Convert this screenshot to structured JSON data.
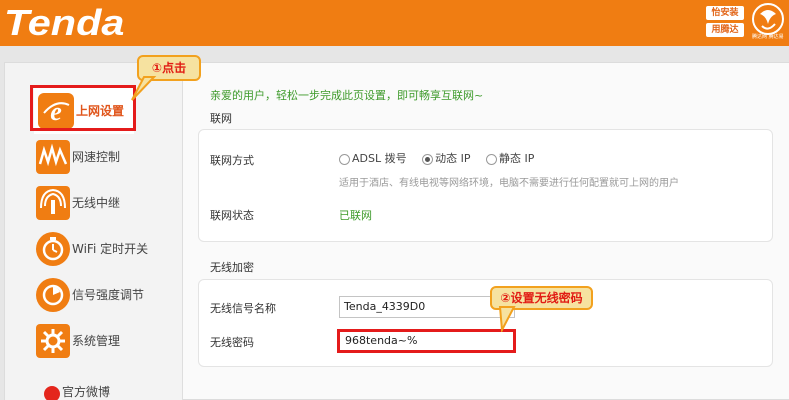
{
  "header": {
    "logo_text": "Tenda",
    "badges": [
      "怡安装",
      "用腾达"
    ],
    "emblem_text": "腾达网 腾达易",
    "brand_color": "#f07d12"
  },
  "sidebar": {
    "items": [
      {
        "label": "上网设置",
        "icon": "internet-e-icon",
        "active": true
      },
      {
        "label": "网速控制",
        "icon": "speed-wave-icon",
        "active": false
      },
      {
        "label": "无线中继",
        "icon": "wifi-relay-icon",
        "active": false
      },
      {
        "label": "WiFi 定时开关",
        "icon": "wifi-timer-icon",
        "active": false
      },
      {
        "label": "信号强度调节",
        "icon": "signal-strength-icon",
        "active": false
      },
      {
        "label": "系统管理",
        "icon": "gear-icon",
        "active": false
      }
    ],
    "footer_label": "官方微博"
  },
  "callouts": {
    "step1": "①点击",
    "step2": "②设置无线密码"
  },
  "main": {
    "intro": "亲爱的用户，轻松一步完成此页设置，即可畅享互联网~",
    "wan": {
      "section_title": "联网",
      "mode_label": "联网方式",
      "modes": [
        {
          "label": "ADSL 拨号",
          "checked": false
        },
        {
          "label": "动态 IP",
          "checked": true
        },
        {
          "label": "静态 IP",
          "checked": false
        }
      ],
      "hint": "适用于酒店、有线电视等网络环境，电脑不需要进行任何配置就可上网的用户",
      "status_label": "联网状态",
      "status_value": "已联网"
    },
    "wireless": {
      "section_title": "无线加密",
      "ssid_label": "无线信号名称",
      "ssid_value": "Tenda_4339D0",
      "password_label": "无线密码",
      "password_value": "968tenda~%"
    }
  }
}
